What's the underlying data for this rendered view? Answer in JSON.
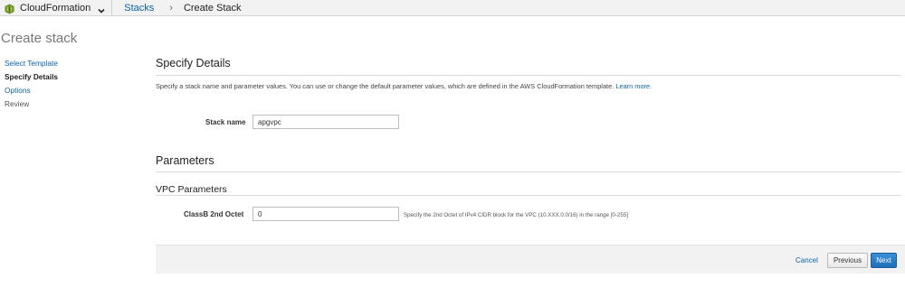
{
  "topbar": {
    "service_label": "CloudFormation",
    "service_icon": "cloudformation-icon",
    "dropdown_icon": "chevron-down-icon",
    "breadcrumb_link": "Stacks",
    "breadcrumb_separator": "›",
    "breadcrumb_current": "Create Stack"
  },
  "page_title": "Create stack",
  "steps": [
    {
      "label": "Select Template",
      "state": "link"
    },
    {
      "label": "Specify Details",
      "state": "active"
    },
    {
      "label": "Options",
      "state": "link"
    },
    {
      "label": "Review",
      "state": "plain"
    }
  ],
  "details": {
    "heading": "Specify Details",
    "intro": "Specify a stack name and parameter values. You can use or change the default parameter values, which are defined in the AWS CloudFormation template.",
    "learn_more": "Learn more.",
    "stack_name_label": "Stack name",
    "stack_name_value": "apgvpc"
  },
  "parameters": {
    "heading": "Parameters",
    "group_heading": "VPC Parameters",
    "classb_label": "ClassB 2nd Octet",
    "classb_value": "0",
    "classb_help": "Specify the 2nd Octet of IPv4 CIDR block for the VPC (10.XXX.0.0/16) in the range [0-255]"
  },
  "footer": {
    "cancel_label": "Cancel",
    "previous_label": "Previous",
    "next_label": "Next"
  },
  "colors": {
    "link": "#0b63a8",
    "primary_button": "#1f6db8",
    "service_icon": "#6a8f1f"
  }
}
